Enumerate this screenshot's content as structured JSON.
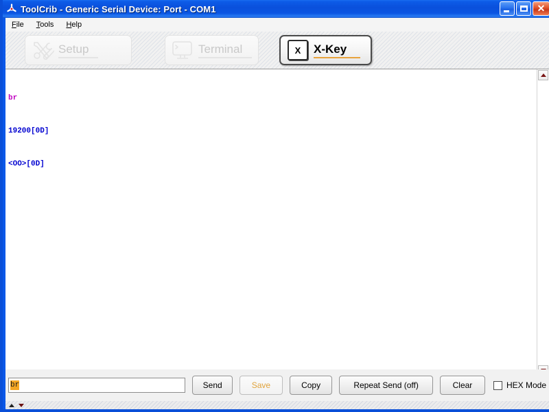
{
  "window": {
    "title": "ToolCrib - Generic Serial Device: Port - COM1",
    "app_icon": "toolcrib-icon",
    "controls": {
      "minimize": "minimize-icon",
      "maximize": "maximize-icon",
      "close": "close-icon",
      "close_glyph": "✕"
    }
  },
  "menubar": {
    "items": [
      {
        "label": "File",
        "mnemonic": "F"
      },
      {
        "label": "Tools",
        "mnemonic": "T"
      },
      {
        "label": "Help",
        "mnemonic": "H"
      }
    ]
  },
  "toolbar": {
    "buttons": [
      {
        "label": "Setup",
        "icon": "hammer-wrench-icon",
        "state": "disabled",
        "active": false
      },
      {
        "label": "Terminal",
        "icon": "monitor-icon",
        "state": "disabled",
        "active": false
      },
      {
        "label": "X-Key",
        "icon": "keycap-x-icon",
        "state": "enabled",
        "active": true,
        "keycap_letter": "X"
      }
    ]
  },
  "terminal": {
    "lines": [
      {
        "text": "br",
        "direction": "sent"
      },
      {
        "text": "19200[0D]",
        "direction": "received"
      },
      {
        "text": "<OO>[0D]",
        "direction": "received"
      }
    ],
    "scrollbar": {
      "up_arrow": "scroll-up-icon",
      "down_arrow": "scroll-down-icon"
    }
  },
  "command_bar": {
    "input": {
      "value": "br",
      "placeholder": "",
      "selected": true
    },
    "buttons": [
      {
        "label": "Send",
        "state": "enabled"
      },
      {
        "label": "Save",
        "state": "disabled"
      },
      {
        "label": "Copy",
        "state": "enabled"
      },
      {
        "label": "Repeat Send (off)",
        "state": "enabled"
      },
      {
        "label": "Clear",
        "state": "enabled"
      }
    ],
    "hex_mode": {
      "label": "HEX Mode",
      "checked": false
    }
  },
  "status_strip": {
    "history_up": "history-up-icon",
    "history_down": "history-down-icon"
  },
  "colors": {
    "title_blue": "#0a50dc",
    "frame_blue": "#0a4fd8",
    "sent_text": "#c000c0",
    "received_text": "#0000d0",
    "accent_orange": "#e8a33d",
    "selection_orange": "#f5a623",
    "disabled_text": "#c9c9c9",
    "scroll_arrow": "#7a1616"
  }
}
